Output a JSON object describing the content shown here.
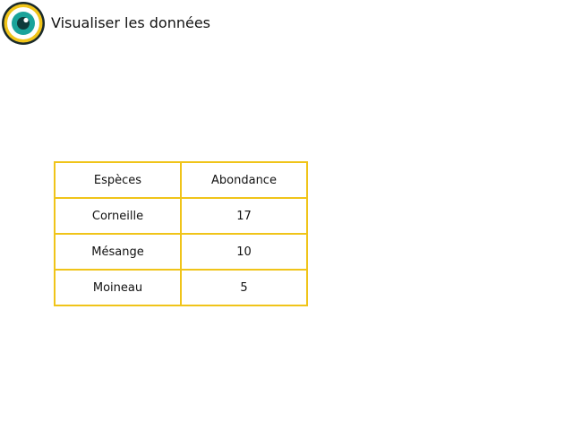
{
  "app": {
    "title": "Visualiser les données",
    "logo_icon": "eye-icon",
    "logo_colors": {
      "ring": "#f0c419",
      "outline": "#1a2a2a",
      "iris": "#1aa39a",
      "pupil": "#0e3b3b"
    }
  },
  "table": {
    "border_color": "#f0c419",
    "headers": [
      "Espèces",
      "Abondance"
    ],
    "rows": [
      [
        "Corneille",
        "17"
      ],
      [
        "Mésange",
        "10"
      ],
      [
        "Moineau",
        "5"
      ]
    ]
  }
}
